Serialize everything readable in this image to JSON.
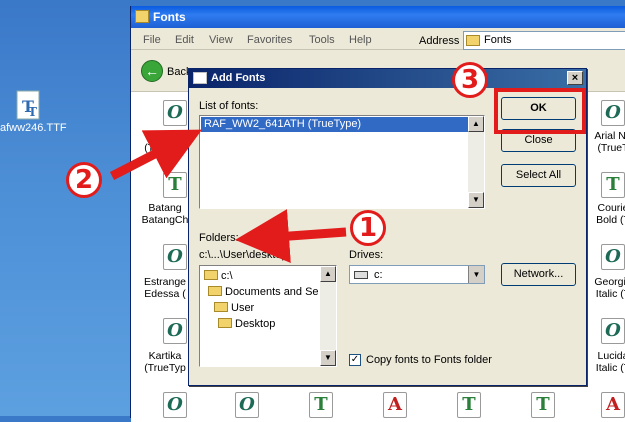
{
  "desktop": {
    "file_label": "afww246.TTF"
  },
  "explorer": {
    "title": "Fonts",
    "menu": [
      "File",
      "Edit",
      "View",
      "Favorites",
      "Tools",
      "Help"
    ],
    "address_label": "Address",
    "address_value": "Fonts",
    "back_label": "Back",
    "fonts": [
      {
        "name": "Agency FB (TrueType)",
        "icon": "font-O-icon"
      },
      {
        "name": "Batang & BatangChe",
        "icon": "font-TT-icon"
      },
      {
        "name": "Estrangelo Edessa",
        "icon": "font-O-icon"
      },
      {
        "name": "Kartika (TrueType)",
        "icon": "font-O-icon"
      },
      {
        "name": "Arial Narrow (TrueType)",
        "icon": "font-O-icon"
      },
      {
        "name": "Courier New Bold (TrueType)",
        "icon": "font-TT-icon"
      },
      {
        "name": "Georgia Italic (TrueType)",
        "icon": "font-O-icon"
      },
      {
        "name": "Lucida Sans Italic (TrueType)",
        "icon": "font-O-icon"
      }
    ],
    "left_col_labels": [
      "Agen",
      "(TrueTyp",
      "Batang",
      "BatangCh",
      "Estrange",
      "Edessa (",
      "Kartika",
      "(TrueTyp"
    ],
    "right_col_labels": [
      "Arial Na",
      "(TrueT",
      "Courie",
      "Bold (T",
      "Georgia",
      "Italic (T",
      "Lucida",
      "Italic (T"
    ]
  },
  "dialog": {
    "title": "Add Fonts",
    "close_glyph": "×",
    "list_label": "List of fonts:",
    "fonts_list": [
      "RAF_WW2_641ATH (TrueType)"
    ],
    "folders_label": "Folders:",
    "folder_path": "c:\\...\\User\\desktop",
    "folder_tree": [
      "c:\\",
      "Documents and Se",
      "User",
      "Desktop"
    ],
    "drives_label": "Drives:",
    "drive_value": "c:",
    "copy_label": "Copy fonts to Fonts folder",
    "copy_checked": true,
    "buttons": {
      "ok": "OK",
      "close": "Close",
      "select_all": "Select All",
      "network": "Network..."
    }
  },
  "annotations": {
    "step1": "1",
    "step2": "2",
    "step3": "3"
  },
  "colors": {
    "highlight": "#e21b1b",
    "selection": "#316ac5"
  }
}
